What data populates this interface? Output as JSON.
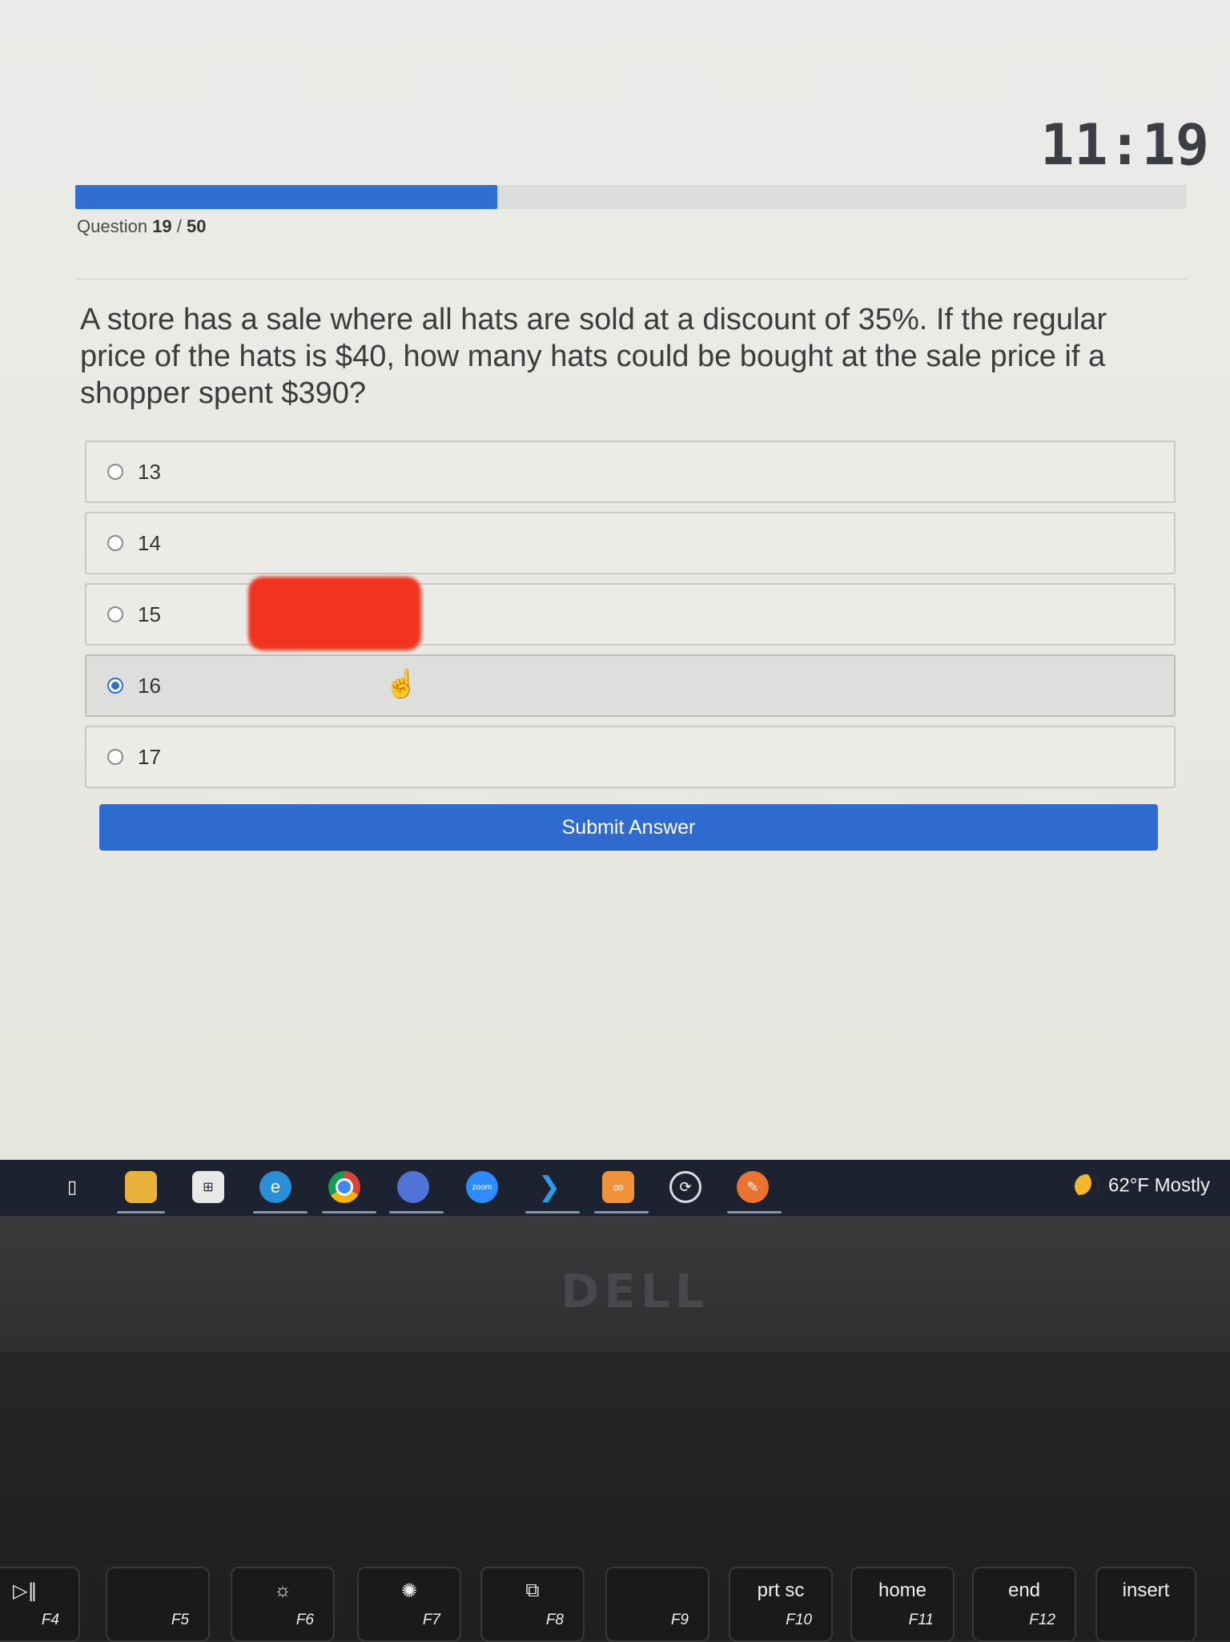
{
  "quiz": {
    "timer": "11:19",
    "progress": {
      "current": 19,
      "total": 50,
      "fraction": 0.38
    },
    "counter_prefix": "Question",
    "counter_current": "19",
    "counter_sep": "/",
    "counter_total": "50",
    "question": "A store has a sale where all hats are sold at a discount of 35%. If the regular price of the hats is $40, how many hats could be bought at the sale price if a shopper spent $390?",
    "options": [
      {
        "label": "13",
        "selected": false
      },
      {
        "label": "14",
        "selected": false
      },
      {
        "label": "15",
        "selected": false
      },
      {
        "label": "16",
        "selected": true
      },
      {
        "label": "17",
        "selected": false
      }
    ],
    "submit_label": "Submit Answer"
  },
  "taskbar": {
    "apps": [
      "task-view-icon",
      "file-explorer-icon",
      "microsoft-store-icon",
      "edge-icon",
      "chrome-icon",
      "chrome-profile-icon",
      "zoom-icon",
      "vscode-icon",
      "app-icon",
      "obs-icon",
      "pen-app-icon"
    ],
    "zoom_text": "zoom",
    "weather": "62°F  Mostly"
  },
  "laptop": {
    "logo": "DELL",
    "keys": [
      {
        "main": "",
        "fn": "F4",
        "icon": "play-pause-icon"
      },
      {
        "main": "",
        "fn": "F5"
      },
      {
        "main": "",
        "fn": "F6",
        "icon": "brightness-down-icon"
      },
      {
        "main": "",
        "fn": "F7",
        "icon": "brightness-up-icon"
      },
      {
        "main": "",
        "fn": "F8",
        "icon": "display-icon"
      },
      {
        "main": "",
        "fn": "F9"
      },
      {
        "main": "prt sc",
        "fn": "F10"
      },
      {
        "main": "home",
        "fn": "F11"
      },
      {
        "main": "end",
        "fn": "F12"
      },
      {
        "main": "insert",
        "fn": ""
      }
    ]
  },
  "colors": {
    "accent": "#2f6fd4",
    "button": "#2f6bcf",
    "redaction": "#f0341f",
    "taskbar": "#1c2230"
  }
}
